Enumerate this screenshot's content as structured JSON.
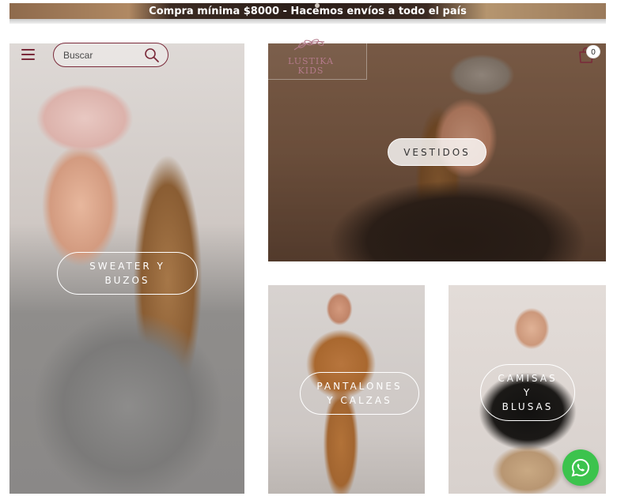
{
  "announcement": {
    "text": "Compra mínima $8000 - Hacemos envíos a todo el país"
  },
  "header": {
    "search_placeholder": "Buscar",
    "logo_text_line1": "LUSTIKA",
    "logo_text_line2": "KIDS",
    "cart_count": "0"
  },
  "categories": [
    {
      "label": "SWEATER Y\nBUZOS"
    },
    {
      "label": "VESTIDOS"
    },
    {
      "label": "PANTALONES\nY CALZAS"
    },
    {
      "label": "CAMISAS\nY\nBLUSAS"
    }
  ],
  "colors": {
    "accent": "#7a2a3a",
    "whatsapp": "#3cc34d"
  },
  "icons": [
    "menu-icon",
    "search-icon",
    "logo-branch-icon",
    "cart-icon",
    "whatsapp-icon"
  ]
}
